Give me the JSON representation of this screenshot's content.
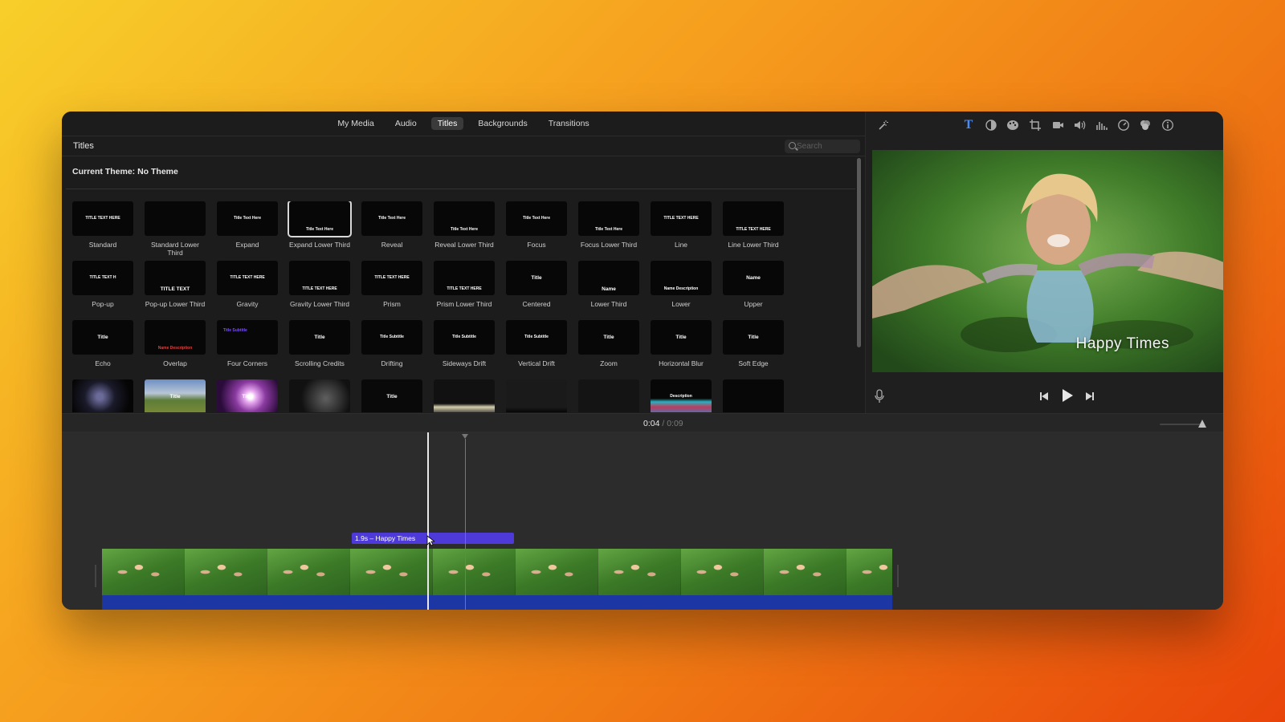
{
  "browser": {
    "tabs": [
      {
        "label": "My Media",
        "active": false
      },
      {
        "label": "Audio",
        "active": false
      },
      {
        "label": "Titles",
        "active": true
      },
      {
        "label": "Backgrounds",
        "active": false
      },
      {
        "label": "Transitions",
        "active": false
      }
    ],
    "title": "Titles",
    "search_placeholder": "Search",
    "theme_label": "Current Theme: No Theme",
    "titles": [
      {
        "name": "Standard",
        "preview": "TITLE TEXT HERE"
      },
      {
        "name": "Standard Lower Third",
        "preview": ""
      },
      {
        "name": "Expand",
        "preview": "Title Text Here"
      },
      {
        "name": "Expand Lower Third",
        "preview": "Title Text Here",
        "selected": true
      },
      {
        "name": "Reveal",
        "preview": "Title Text Here"
      },
      {
        "name": "Reveal Lower Third",
        "preview": "Title Text Here"
      },
      {
        "name": "Focus",
        "preview": "Title Text Here"
      },
      {
        "name": "Focus Lower Third",
        "preview": "Title Text Here"
      },
      {
        "name": "Line",
        "preview": "TITLE TEXT HERE"
      },
      {
        "name": "Line Lower Third",
        "preview": "TITLE TEXT HERE"
      },
      {
        "name": "Pop-up",
        "preview": "TITLE TEXT H"
      },
      {
        "name": "Pop-up Lower Third",
        "preview": "TITLE TEXT"
      },
      {
        "name": "Gravity",
        "preview": "TITLE TEXT HERE"
      },
      {
        "name": "Gravity Lower Third",
        "preview": "TITLE TEXT HERE"
      },
      {
        "name": "Prism",
        "preview": "TITLE TEXT HERE"
      },
      {
        "name": "Prism Lower Third",
        "preview": "TITLE TEXT HERE"
      },
      {
        "name": "Centered",
        "preview": "Title"
      },
      {
        "name": "Lower Third",
        "preview": "Name"
      },
      {
        "name": "Lower",
        "preview": "Name Description"
      },
      {
        "name": "Upper",
        "preview": "Name"
      },
      {
        "name": "Echo",
        "preview": "Title"
      },
      {
        "name": "Overlap",
        "preview": "Name Description"
      },
      {
        "name": "Four Corners",
        "preview": "Title Subtitle"
      },
      {
        "name": "Scrolling Credits",
        "preview": "Title"
      },
      {
        "name": "Drifting",
        "preview": "Title Subtitle"
      },
      {
        "name": "Sideways Drift",
        "preview": "Title Subtitle"
      },
      {
        "name": "Vertical Drift",
        "preview": "Title Subtitle"
      },
      {
        "name": "Zoom",
        "preview": "Title"
      },
      {
        "name": "Horizontal Blur",
        "preview": "Title"
      },
      {
        "name": "Soft Edge",
        "preview": "Title"
      },
      {
        "name": "",
        "preview": ""
      },
      {
        "name": "",
        "preview": "Title"
      },
      {
        "name": "",
        "preview": "Title"
      },
      {
        "name": "",
        "preview": ""
      },
      {
        "name": "",
        "preview": "Title"
      },
      {
        "name": "",
        "preview": ""
      },
      {
        "name": "",
        "preview": ""
      },
      {
        "name": "",
        "preview": ""
      },
      {
        "name": "",
        "preview": "Description"
      },
      {
        "name": "",
        "preview": ""
      }
    ]
  },
  "viewer": {
    "overlay_title": "Happy Times"
  },
  "timeline": {
    "current_time": "0:04",
    "separator": "/",
    "total_time": "0:09",
    "title_clip_label": "1.9s – Happy Times"
  }
}
